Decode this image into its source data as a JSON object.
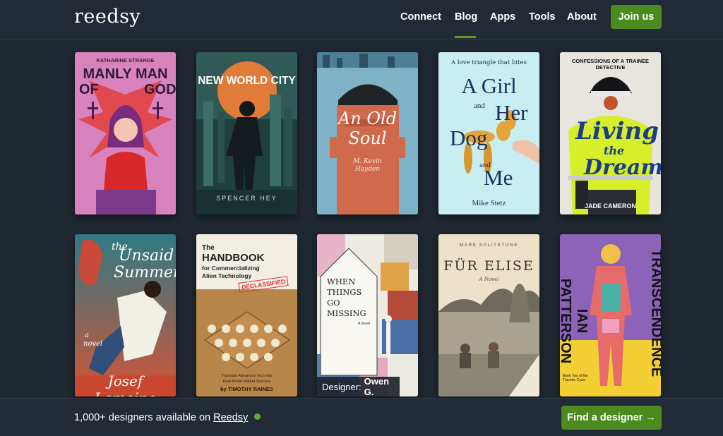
{
  "brand": {
    "logo": "reedsy"
  },
  "nav": {
    "connect": "Connect",
    "blog": "Blog",
    "apps": "Apps",
    "tools": "Tools",
    "about": "About",
    "join": "Join us",
    "active": "Blog"
  },
  "books": {
    "b1": {
      "author": "KATHARINE STRANGE",
      "title1": "MANLY MAN",
      "title2": "OF",
      "title3": "GOD"
    },
    "b2": {
      "title": "NEW WORLD CITY",
      "author": "SPENCER HEY"
    },
    "b3": {
      "title1": "An Old",
      "title2": "Soul",
      "author1": "M. Kevin",
      "author2": "Hayden"
    },
    "b4": {
      "tagline": "A love triangle that bites",
      "t1": "A Girl",
      "t2": "and",
      "t3": "Her",
      "t4": "Dog",
      "t5": "and",
      "t6": "Me",
      "author": "Mike Stetz"
    },
    "b5": {
      "series": "CONFESSIONS OF A TRAINEE DETECTIVE",
      "t1": "Living",
      "t2": "the",
      "t3": "Dream",
      "author": "JADE CAMERON"
    },
    "b6": {
      "t1": "the",
      "t2": "Unsaid",
      "t3": "Summer",
      "genre1": "a",
      "genre2": "novel",
      "author": "Josef Lemoine"
    },
    "b7": {
      "t1": "The",
      "t2": "HANDBOOK",
      "t3": "for Commercializing",
      "t4": "Alien Technology",
      "stamp": "DECLASSIFIED",
      "sub1": "Translate Advanced Tech into",
      "sub2": "Real-World Market Success",
      "author": "by TIMOTHY RAINES"
    },
    "b8": {
      "t1": "WHEN",
      "t2": "THINGS",
      "t3": "GO",
      "t4": "MISSING",
      "sub": "A Novel",
      "designer_label": "Designer:",
      "designer_name": "Owen G."
    },
    "b9": {
      "author": "MARK SPLITSTONE",
      "title": "FÜR ELISE",
      "sub": "A Novel"
    },
    "b10": {
      "author": "IAN PATTERSON",
      "title": "TRANSCENDENCE",
      "sub": "Book Two of the Traveler Cycle"
    }
  },
  "footer": {
    "text_prefix": "1,000+ designers available on",
    "link": "Reedsy",
    "cta": "Find a designer →"
  },
  "colors": {
    "background": "#1f2731",
    "accent": "#4a8a1f",
    "status_dot": "#5fae2e"
  }
}
